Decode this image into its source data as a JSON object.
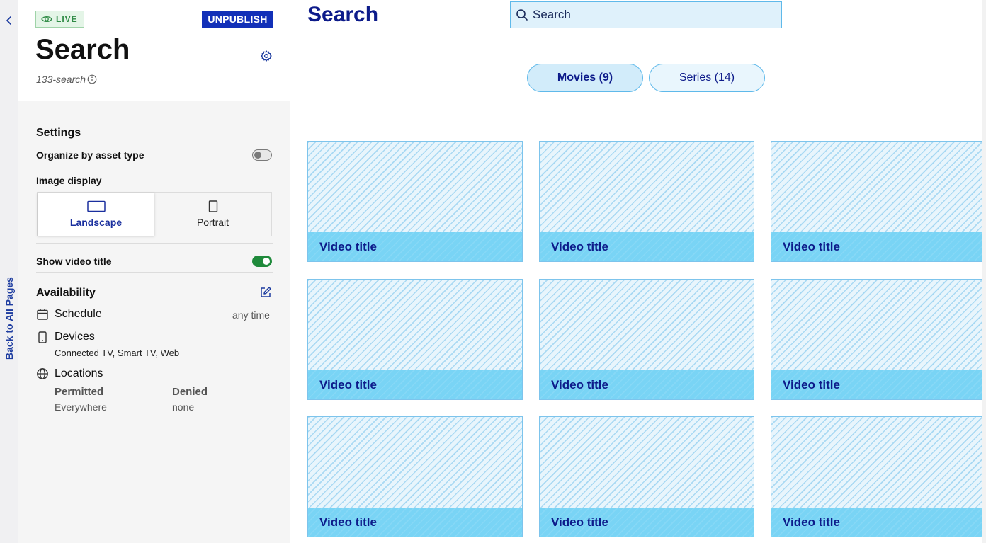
{
  "rail": {
    "back_label": "Back to All Pages"
  },
  "header": {
    "live_label": "LIVE",
    "unpublish_label": "UNPUBLISH",
    "page_title": "Search",
    "slug": "133-search"
  },
  "settings": {
    "title": "Settings",
    "organize_label": "Organize by asset type",
    "organize_on": false,
    "image_display_label": "Image display",
    "image_options": [
      {
        "label": "Landscape",
        "selected": true
      },
      {
        "label": "Portrait",
        "selected": false
      }
    ],
    "show_title_label": "Show video title",
    "show_title_on": true
  },
  "availability": {
    "title": "Availability",
    "schedule_label": "Schedule",
    "schedule_value": "any time",
    "devices_label": "Devices",
    "devices_value": "Connected TV, Smart TV, Web",
    "locations_label": "Locations",
    "permitted_label": "Permitted",
    "permitted_value": "Everywhere",
    "denied_label": "Denied",
    "denied_value": "none"
  },
  "preview": {
    "title": "Search",
    "search_placeholder": "Search",
    "tabs": [
      {
        "label": "Movies (9)",
        "active": true
      },
      {
        "label": "Series (14)",
        "active": false
      }
    ],
    "tiles": [
      "Video title",
      "Video title",
      "Video title",
      "Video title",
      "Video title",
      "Video title",
      "Video title",
      "Video title",
      "Video title"
    ]
  },
  "colors": {
    "brand_navy": "#0d1b8a",
    "unpublish_bg": "#1230b8",
    "live_green": "#2e8a44",
    "toggle_on": "#1f8a3b",
    "tile_caption": "#79d4f5",
    "accent_blue": "#5fb9ea"
  },
  "icons": [
    "chevron-left-icon",
    "eye-icon",
    "gear-icon",
    "info-icon",
    "landscape-icon",
    "portrait-icon",
    "edit-icon",
    "calendar-icon",
    "device-icon",
    "globe-icon",
    "search-icon"
  ]
}
